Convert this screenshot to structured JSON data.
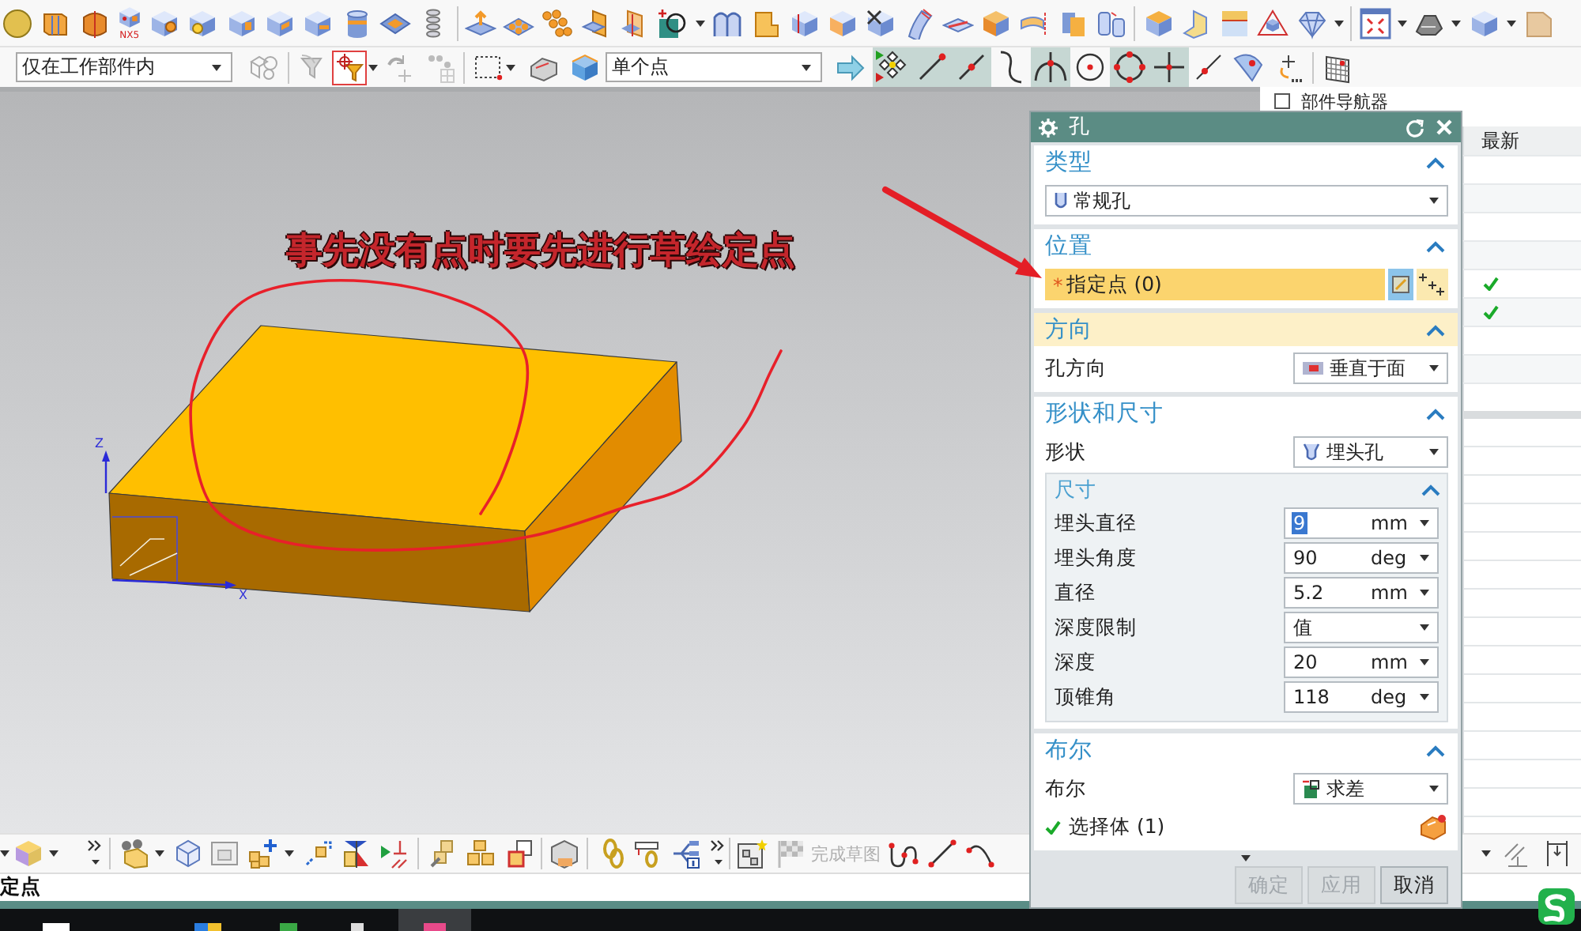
{
  "toolbar": {
    "badge": "NX5"
  },
  "selection_bar": {
    "scope_filter": "仅在工作部件内",
    "type_filter_on": true,
    "point_mode": "单个点",
    "snap_toggles": [
      {
        "kind": "point_set",
        "on": true
      },
      {
        "kind": "end_point",
        "on": true
      },
      {
        "kind": "mid_point",
        "on": true
      },
      {
        "kind": "curve",
        "on": false
      },
      {
        "kind": "arc_cross",
        "on": true
      },
      {
        "kind": "circle_center",
        "on": false
      },
      {
        "kind": "circle_quadrant",
        "on": true
      },
      {
        "kind": "cross",
        "on": true
      },
      {
        "kind": "line_point",
        "on": false
      },
      {
        "kind": "surface_point",
        "on": false
      }
    ]
  },
  "graphics": {
    "annotation": "事先没有点时要先进行草绘定点",
    "axis_labels": [
      {
        "kind": "z",
        "text": "Z"
      },
      {
        "kind": "x",
        "text": "X"
      }
    ]
  },
  "part_navigator": {
    "title": "部件导航器",
    "columns": [
      {
        "label": "最新"
      }
    ],
    "rows": [
      {
        "latest": false
      },
      {
        "latest": false
      },
      {
        "latest": false
      },
      {
        "latest": false
      },
      {
        "latest": true
      },
      {
        "latest": true
      },
      {
        "latest": false
      },
      {
        "latest": false
      },
      {
        "latest": false
      }
    ]
  },
  "dialog": {
    "title": "孔",
    "sections": [
      {
        "title": "类型",
        "expanded": true,
        "highlighted": false,
        "rows": [
          {
            "kind": "icon_dropdown",
            "value": "常规孔"
          }
        ]
      },
      {
        "title": "位置",
        "expanded": true,
        "highlighted": false,
        "rows": [
          {
            "kind": "selection",
            "mark": "*",
            "label": "指定点 (0)",
            "active": true
          }
        ]
      },
      {
        "title": "方向",
        "expanded": true,
        "highlighted": true,
        "rows": [
          {
            "kind": "icon_dropdown",
            "label": "孔方向",
            "value": "垂直于面"
          }
        ]
      },
      {
        "title": "形状和尺寸",
        "expanded": true,
        "highlighted": false,
        "rows": [
          {
            "kind": "icon_dropdown",
            "label": "形状",
            "value": "埋头孔"
          },
          {
            "kind": "group",
            "title": "尺寸",
            "expanded": true,
            "rows": [
              {
                "kind": "number",
                "label": "埋头直径",
                "value": "9",
                "unit": "mm",
                "text_selected": true
              },
              {
                "kind": "number",
                "label": "埋头角度",
                "value": "90",
                "unit": "deg",
                "text_selected": false
              },
              {
                "kind": "number",
                "label": "直径",
                "value": "5.2",
                "unit": "mm",
                "text_selected": false
              },
              {
                "kind": "dropdown",
                "label": "深度限制",
                "value": "值"
              },
              {
                "kind": "number",
                "label": "深度",
                "value": "20",
                "unit": "mm",
                "text_selected": false
              },
              {
                "kind": "number",
                "label": "顶锥角",
                "value": "118",
                "unit": "deg",
                "text_selected": false
              }
            ]
          }
        ]
      },
      {
        "title": "布尔",
        "expanded": true,
        "highlighted": false,
        "rows": [
          {
            "kind": "icon_dropdown",
            "label": "布尔",
            "value": "求差"
          },
          {
            "kind": "selected_objects",
            "label": "选择体 (1)",
            "complete": true
          }
        ]
      }
    ],
    "buttons": [
      {
        "label": "确定",
        "disabled": true
      },
      {
        "label": "应用",
        "disabled": true
      },
      {
        "label": "取消",
        "disabled": false
      }
    ]
  },
  "sketch_toolbar": {
    "finish_label": "完成草图",
    "finish_disabled": true
  },
  "status_bar": {
    "text": "定点"
  }
}
